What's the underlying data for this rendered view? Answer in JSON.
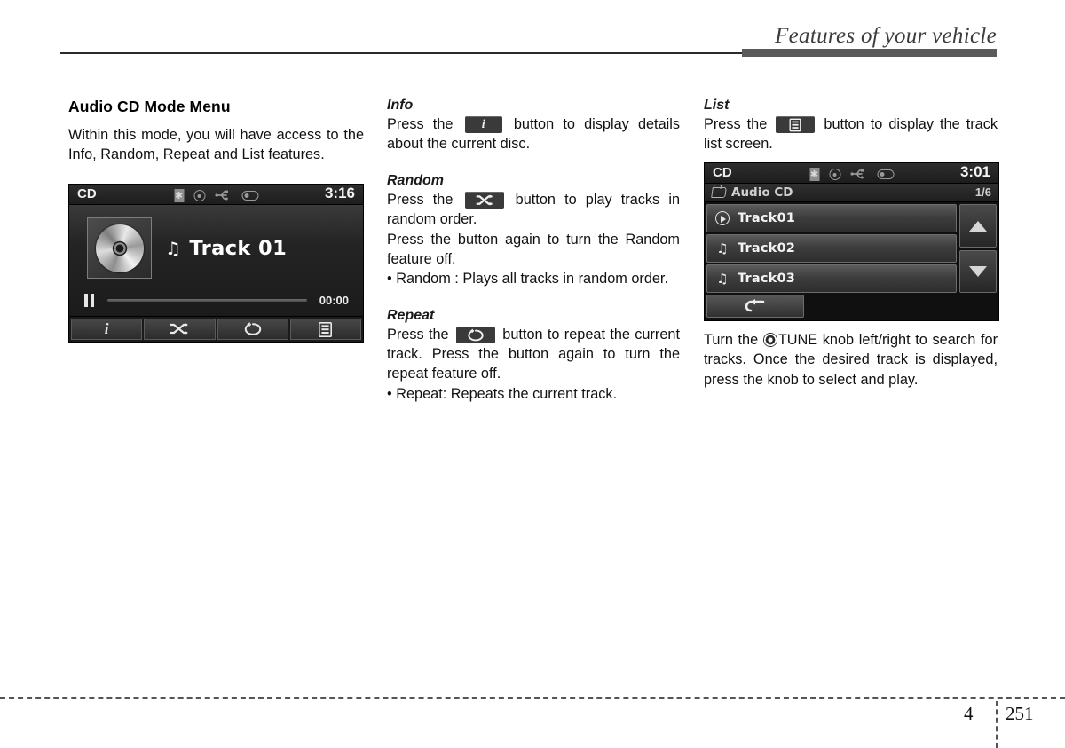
{
  "header": {
    "title": "Features of your vehicle"
  },
  "footer": {
    "chapter": "4",
    "page": "251"
  },
  "left": {
    "heading": "Audio CD Mode Menu",
    "intro": "Within this mode, you will have access to the Info, Random, Repeat and List features.",
    "player": {
      "source": "CD",
      "clock": "3:16",
      "track_title": "Track 01",
      "elapsed": "00:00",
      "buttons": [
        {
          "name": "info",
          "glyph": "i"
        },
        {
          "name": "random",
          "glyph": "shuffle"
        },
        {
          "name": "repeat",
          "glyph": "repeat"
        },
        {
          "name": "list",
          "glyph": "list"
        }
      ]
    }
  },
  "middle": {
    "info": {
      "heading": "Info",
      "text_before": "Press the",
      "text_after": "button to display details about the current disc."
    },
    "random": {
      "heading": "Random",
      "text_before": "Press the",
      "text_after": "button to play tracks in random order.",
      "line2": "Press the button again to turn the Random feature off.",
      "bullet": "• Random : Plays all tracks in random order."
    },
    "repeat": {
      "heading": "Repeat",
      "text_before": "Press the",
      "text_after": "button to repeat the current track. Press the button again to turn the repeat feature off.",
      "bullet": "• Repeat: Repeats the current track."
    }
  },
  "right": {
    "list": {
      "heading": "List",
      "text_before": "Press the",
      "text_after": "button to display the track list screen."
    },
    "list_screen": {
      "source": "CD",
      "clock": "3:01",
      "folder": "Audio CD",
      "counter": "1/6",
      "tracks": [
        {
          "label": "Track01",
          "icon": "play-icon",
          "playing": true
        },
        {
          "label": "Track02",
          "icon": "music-note-icon",
          "playing": false
        },
        {
          "label": "Track03",
          "icon": "music-note-icon",
          "playing": false
        }
      ],
      "back_label": "↩"
    },
    "tune_text_before": "Turn the",
    "tune_text_after": "TUNE knob left/right to search for tracks. Once the desired track is displayed, press the knob to select and play."
  },
  "glyphs": {
    "music_note": "♫",
    "bt": "฿"
  }
}
